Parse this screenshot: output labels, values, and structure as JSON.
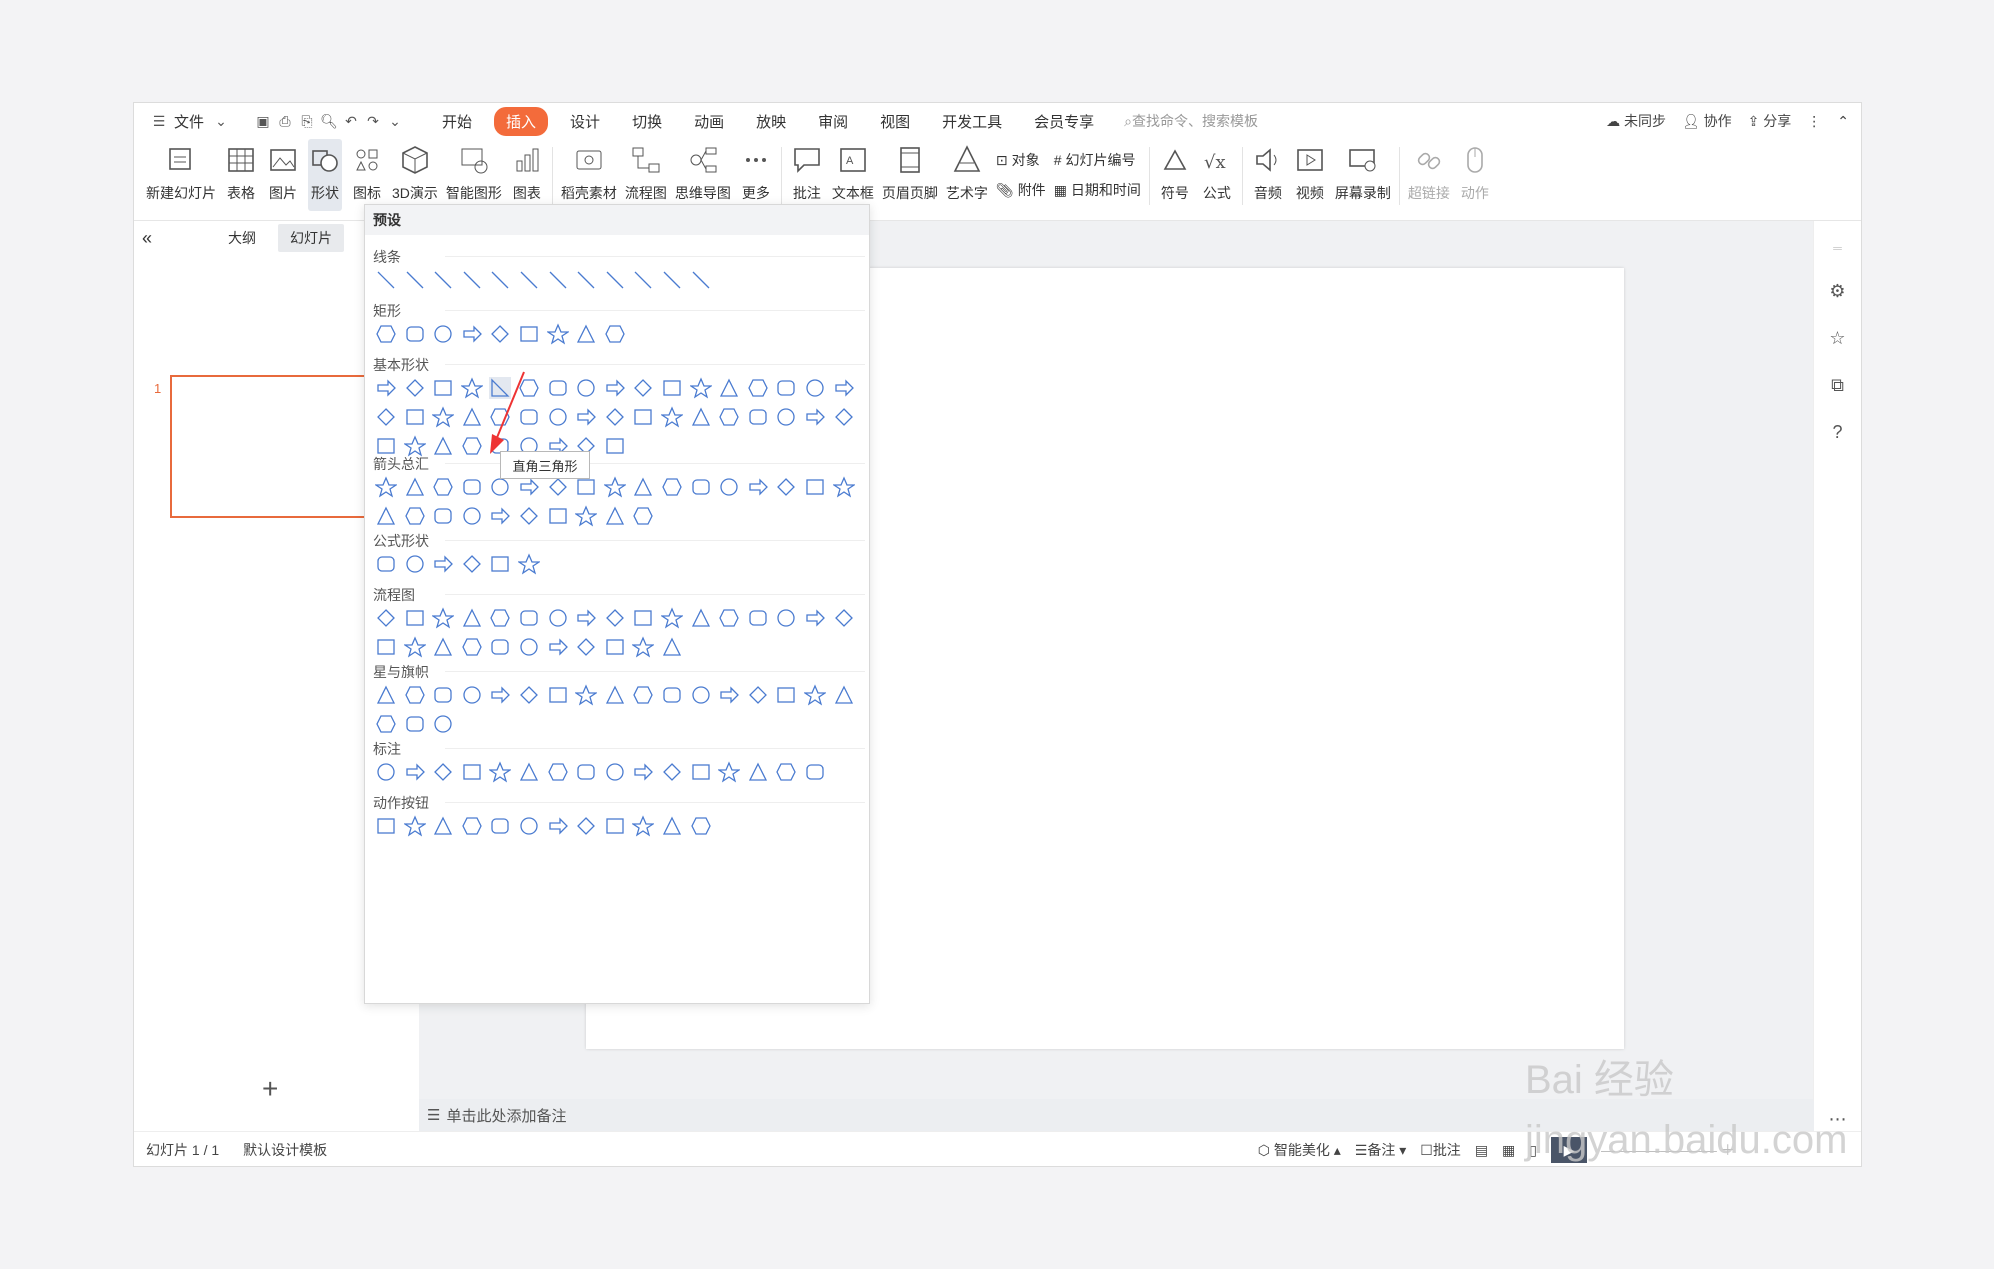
{
  "menubar": {
    "file": "文件",
    "items": [
      "开始",
      "插入",
      "设计",
      "切换",
      "动画",
      "放映",
      "审阅",
      "视图",
      "开发工具",
      "会员专享"
    ],
    "active": "插入",
    "search_placeholder": "查找命令、搜索模板",
    "right": [
      "未同步",
      "协作",
      "分享"
    ]
  },
  "ribbon": {
    "groupA": [
      {
        "label": "新建幻灯片",
        "icon": "new-slide-icon"
      },
      {
        "label": "表格",
        "icon": "table-icon"
      },
      {
        "label": "图片",
        "icon": "picture-icon"
      },
      {
        "label": "形状",
        "icon": "shapes-icon"
      },
      {
        "label": "图标",
        "icon": "icons-icon"
      },
      {
        "label": "3D演示",
        "icon": "3d-icon"
      },
      {
        "label": "智能图形",
        "icon": "smartart-icon"
      },
      {
        "label": "图表",
        "icon": "chart-icon"
      }
    ],
    "groupB": [
      {
        "label": "稻壳素材",
        "icon": "material-icon"
      },
      {
        "label": "流程图",
        "icon": "flowchart-icon"
      },
      {
        "label": "思维导图",
        "icon": "mindmap-icon"
      },
      {
        "label": "更多",
        "icon": "more-icon"
      }
    ],
    "groupC": [
      {
        "label": "批注",
        "icon": "comment-icon"
      },
      {
        "label": "文本框",
        "icon": "textbox-icon"
      },
      {
        "label": "页眉页脚",
        "icon": "header-footer-icon"
      },
      {
        "label": "艺术字",
        "icon": "wordart-icon"
      }
    ],
    "small": {
      "object": "对象",
      "attachment": "附件",
      "slide_number": "幻灯片编号",
      "datetime": "日期和时间"
    },
    "groupD": [
      {
        "label": "符号",
        "icon": "symbol-icon"
      },
      {
        "label": "公式",
        "icon": "formula-icon"
      },
      {
        "label": "音频",
        "icon": "audio-icon"
      },
      {
        "label": "视频",
        "icon": "video-icon"
      },
      {
        "label": "屏幕录制",
        "icon": "screen-record-icon"
      },
      {
        "label": "超链接",
        "icon": "hyperlink-icon"
      },
      {
        "label": "动作",
        "icon": "action-icon"
      }
    ]
  },
  "left": {
    "tabs": [
      "大纲",
      "幻灯片"
    ],
    "active_tab": "幻灯片",
    "slide_number": "1"
  },
  "shapes_menu": {
    "header": "预设",
    "sections": [
      "线条",
      "矩形",
      "基本形状",
      "箭头总汇",
      "公式形状",
      "流程图",
      "星与旗帜",
      "标注",
      "动作按钮"
    ],
    "tooltip": "直角三角形"
  },
  "notes": "单击此处添加备注",
  "status": {
    "slide": "幻灯片 1 / 1",
    "template": "默认设计模板",
    "beautify": "智能美化",
    "notes": "备注",
    "comments": "批注"
  },
  "watermark": "Bai 经验 jingyan.baidu.com"
}
